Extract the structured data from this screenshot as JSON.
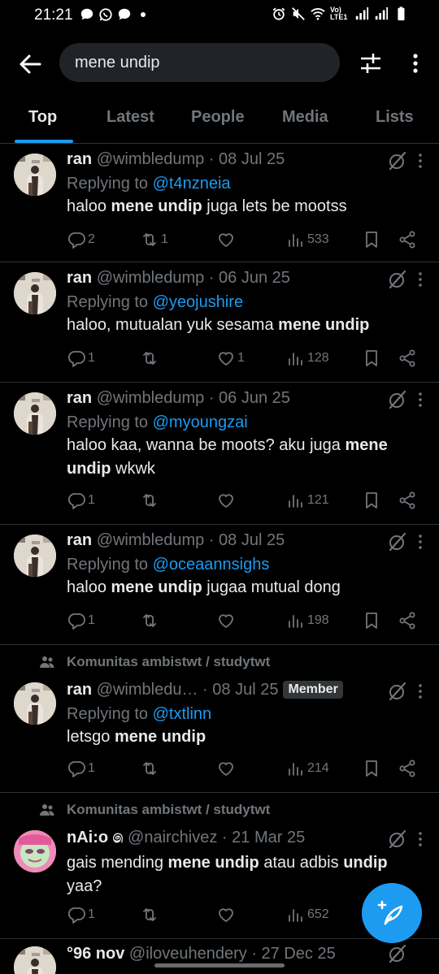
{
  "status_bar": {
    "time": "21:21",
    "network": "Vo) LTE1"
  },
  "search": {
    "query": "mene undip"
  },
  "tabs": [
    {
      "label": "Top",
      "active": true
    },
    {
      "label": "Latest",
      "active": false
    },
    {
      "label": "People",
      "active": false
    },
    {
      "label": "Media",
      "active": false
    },
    {
      "label": "Lists",
      "active": false
    }
  ],
  "tweets": [
    {
      "name": "ran",
      "handle": "@wimbledump",
      "date": "· 08 Jul 25",
      "replying_label": "Replying to",
      "replying_to": "@t4nzneia",
      "text_parts": [
        "haloo ",
        "mene undip",
        " juga lets be mootss"
      ],
      "replies": "2",
      "reposts": "1",
      "likes": "",
      "views": "533"
    },
    {
      "name": "ran",
      "handle": "@wimbledump",
      "date": "· 06 Jun 25",
      "replying_label": "Replying to",
      "replying_to": "@yeojushire",
      "text_parts": [
        "haloo, mutualan yuk sesama ",
        "mene undip",
        ""
      ],
      "replies": "1",
      "reposts": "",
      "likes": "1",
      "views": "128"
    },
    {
      "name": "ran",
      "handle": "@wimbledump",
      "date": "· 06 Jun 25",
      "replying_label": "Replying to",
      "replying_to": "@myoungzai",
      "text_parts": [
        "haloo kaa, wanna be moots? aku juga ",
        "mene undip",
        " wkwk"
      ],
      "replies": "1",
      "reposts": "",
      "likes": "",
      "views": "121"
    },
    {
      "name": "ran",
      "handle": "@wimbledump",
      "date": "· 08 Jul 25",
      "replying_label": "Replying to",
      "replying_to": "@oceaannsighs",
      "text_parts": [
        "haloo ",
        "mene undip",
        " jugaa mutual dong"
      ],
      "replies": "1",
      "reposts": "",
      "likes": "",
      "views": "198"
    },
    {
      "community": "Komunitas ambistwt / studytwt",
      "name": "ran",
      "handle": "@wimbledu…",
      "date": "· 08 Jul 25",
      "badge": "Member",
      "replying_label": "Replying to",
      "replying_to": "@txtlinn",
      "text_parts": [
        "letsgo ",
        "mene undip",
        ""
      ],
      "replies": "1",
      "reposts": "",
      "likes": "",
      "views": "214"
    },
    {
      "community": "Komunitas ambistwt / studytwt",
      "name": "nAi:o ෧",
      "handle": "@nairchivez",
      "date": "· 21 Mar 25",
      "text_a": "gais mending ",
      "text_b": "mene undip",
      "text_c": " atau adbis ",
      "text_d": "undip",
      "text_e": "yaa?",
      "replies": "1",
      "reposts": "",
      "likes": "",
      "views": "652"
    }
  ],
  "peek_tweet": {
    "name": "°96 nov",
    "handle": "@iloveuhendery",
    "date": "· 27 Dec 25"
  },
  "colors": {
    "accent": "#1d9bf0",
    "background": "#000000",
    "secondary_text": "#71767b"
  }
}
